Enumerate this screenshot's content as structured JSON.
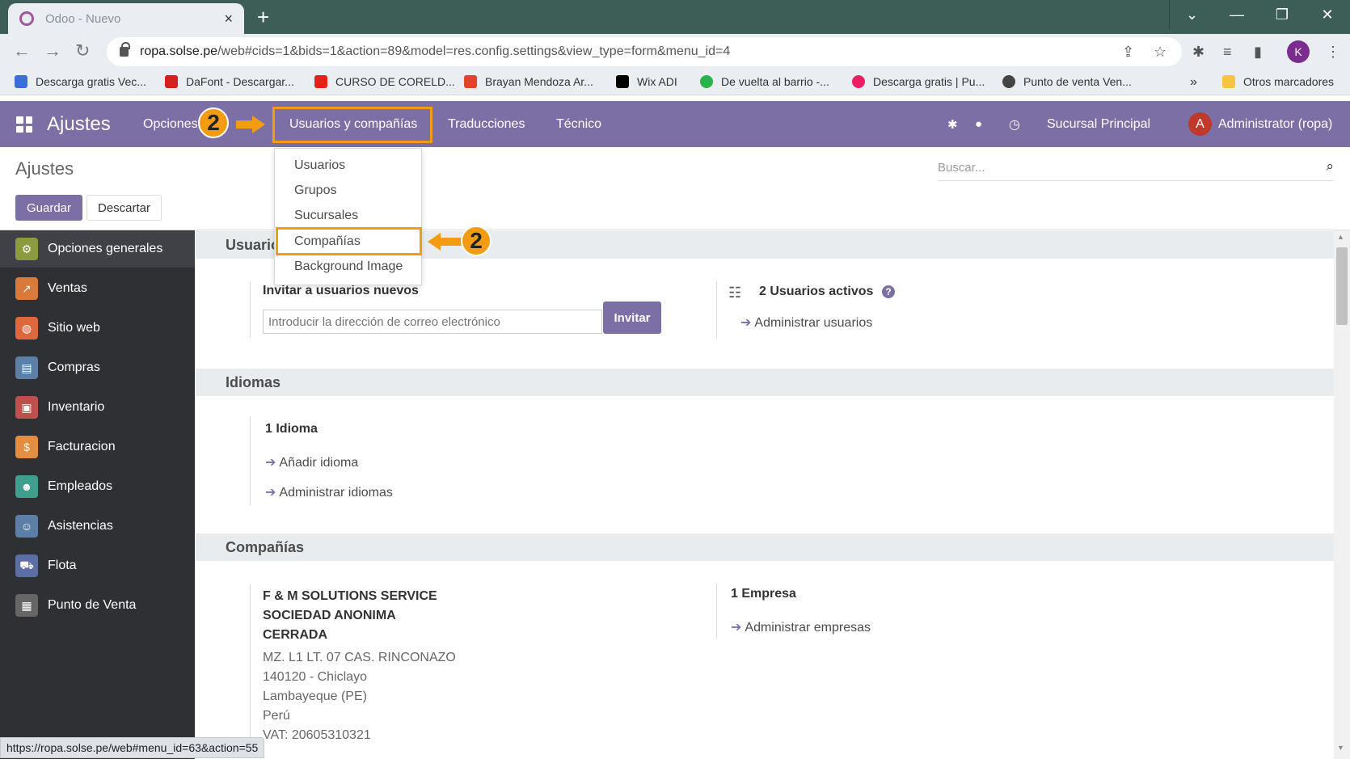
{
  "browser": {
    "tab_title": "Odoo - Nuevo",
    "tab_close": "×",
    "new_tab": "+",
    "url": "ropa.solse.pe",
    "url_path": "/web#cids=1&bids=1&action=89&model=res.config.settings&view_type=form&menu_id=4",
    "profile_initial": "K",
    "bookmarks": [
      {
        "label": "Descarga gratis Vec...",
        "color": "#3b6fd8"
      },
      {
        "label": "DaFont - Descargar...",
        "color": "#d4201f"
      },
      {
        "label": "CURSO DE CORELD...",
        "color": "#e62117"
      },
      {
        "label": "Brayan Mendoza Ar...",
        "color": "#e24329"
      },
      {
        "label": "Wix ADI",
        "color": "#000000"
      },
      {
        "label": "De vuelta al barrio -...",
        "color": "#2bb24c"
      },
      {
        "label": "Descarga gratis | Pu...",
        "color": "#e91e63"
      },
      {
        "label": "Punto de venta Ven...",
        "color": "#444444"
      }
    ],
    "bookmarks_more": "»",
    "other_bookmarks": "Otros marcadores",
    "status_url": "https://ropa.solse.pe/web#menu_id=63&action=55"
  },
  "navbar": {
    "app_name": "Ajustes",
    "menus": [
      "Opciones",
      "Usuarios y compañías",
      "Traducciones",
      "Técnico"
    ],
    "branch": "Sucursal Principal",
    "user_initial": "A",
    "user_name": "Administrator (ropa)"
  },
  "annotations": {
    "step_number": "2",
    "accent": "#f39c12"
  },
  "dropdown": {
    "items": [
      "Usuarios",
      "Grupos",
      "Sucursales",
      "Compañías",
      "Background Image"
    ],
    "highlighted": "Compañías"
  },
  "control_panel": {
    "breadcrumb": "Ajustes",
    "save": "Guardar",
    "discard": "Descartar",
    "search_placeholder": "Buscar..."
  },
  "sidebar": {
    "items": [
      {
        "label": "Opciones generales",
        "color": "#8c9b3e"
      },
      {
        "label": "Ventas",
        "color": "#d97a3a"
      },
      {
        "label": "Sitio web",
        "color": "#e0663b"
      },
      {
        "label": "Compras",
        "color": "#5b7fa6"
      },
      {
        "label": "Inventario",
        "color": "#c0504d"
      },
      {
        "label": "Facturacion",
        "color": "#e58c3e"
      },
      {
        "label": "Empleados",
        "color": "#3f9f8f"
      },
      {
        "label": "Asistencias",
        "color": "#5b7fa6"
      },
      {
        "label": "Flota",
        "color": "#5b6fa6"
      },
      {
        "label": "Punto de Venta",
        "color": "#666666"
      }
    ],
    "active": "Opciones generales"
  },
  "users_section": {
    "title": "Usuarios",
    "invite_label": "Invitar a usuarios nuevos",
    "email_placeholder": "Introducir la dirección de correo electrónico",
    "invite_button": "Invitar",
    "active_users": "2 Usuarios activos",
    "manage_users": "Administrar usuarios"
  },
  "languages_section": {
    "title": "Idiomas",
    "count": "1 Idioma",
    "add_language": "Añadir idioma",
    "manage_languages": "Administrar idiomas"
  },
  "companies_section": {
    "title": "Compañías",
    "company_name_1": "F & M SOLUTIONS SERVICE",
    "company_name_2": "SOCIEDAD ANONIMA",
    "company_name_3": "CERRADA",
    "address_1": "MZ. L1 LT. 07 CAS. RINCONAZO",
    "address_2": "140120 - Chiclayo",
    "address_3": "Lambayeque (PE)",
    "country": "Perú",
    "vat": "VAT: 20605310321",
    "count": "1 Empresa",
    "manage_companies": "Administrar empresas"
  }
}
